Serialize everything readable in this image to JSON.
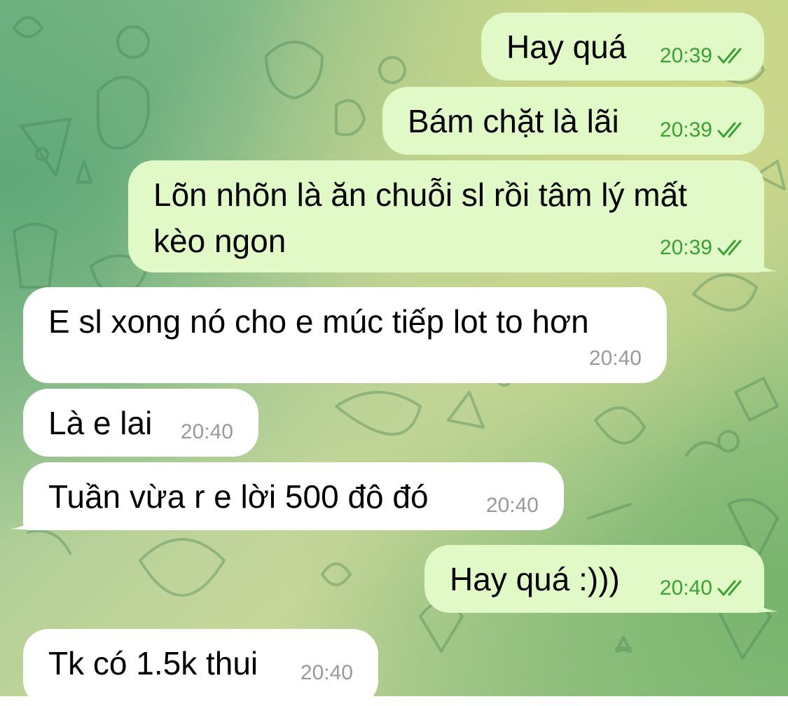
{
  "theme": {
    "outgoing_bubble": "#e1f8c7",
    "incoming_bubble": "#ffffff",
    "outgoing_time_color": "#3aa233",
    "incoming_time_color": "#9a9a9a"
  },
  "messages": [
    {
      "direction": "outgoing",
      "lines": [
        "Hay quá"
      ],
      "time": "20:39",
      "status_icon": "double-check-icon"
    },
    {
      "direction": "outgoing",
      "lines": [
        "Bám chặt là lãi"
      ],
      "time": "20:39",
      "status_icon": "double-check-icon"
    },
    {
      "direction": "outgoing",
      "lines": [
        "Lõn nhõn là ăn chuỗi sl rồi tâm lý mất",
        "kèo ngon"
      ],
      "time": "20:39",
      "status_icon": "double-check-icon"
    },
    {
      "direction": "incoming",
      "lines": [
        "E sl xong nó cho e múc tiếp lot to hơn"
      ],
      "time": "20:40"
    },
    {
      "direction": "incoming",
      "lines": [
        "Là e lai"
      ],
      "time": "20:40"
    },
    {
      "direction": "incoming",
      "lines": [
        "Tuần vừa r e lời 500 đô đó"
      ],
      "time": "20:40"
    },
    {
      "direction": "outgoing",
      "lines": [
        "Hay quá :)))"
      ],
      "time": "20:40",
      "status_icon": "double-check-icon"
    },
    {
      "direction": "incoming",
      "lines": [
        "Tk có 1.5k thui"
      ],
      "time": "20:40"
    }
  ]
}
